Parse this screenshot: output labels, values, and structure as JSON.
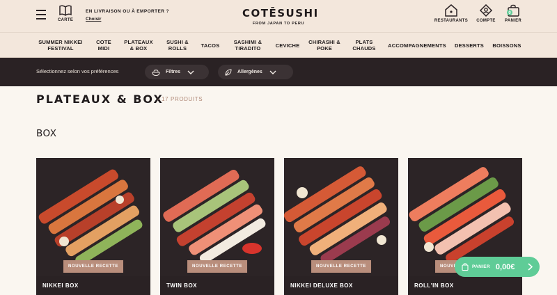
{
  "header": {
    "carte_label": "CARTE",
    "delivery_line": "EN LIVRAISON OU À EMPORTER ?",
    "delivery_link": "Choisir",
    "logo_name": "COTĒSUSHI",
    "logo_tagline": "FROM JAPAN TO PERU",
    "restaurants_label": "RESTAURANTS",
    "compte_label": "COMPTE",
    "panier_label": "PANIER",
    "panier_count": "0"
  },
  "nav": {
    "items": [
      "SUMMER NIKKEI\nFESTIVAL",
      "COTE\nMIDI",
      "PLATEAUX\n& BOX",
      "SUSHI &\nROLLS",
      "TACOS",
      "SASHIMI &\nTIRADITO",
      "CEVICHE",
      "CHIRASHI &\nPOKE",
      "PLATS\nCHAUDS",
      "ACCOMPAGNEMENTS",
      "DESSERTS",
      "BOISSONS"
    ]
  },
  "filters": {
    "prompt": "Sélectionnez selon vos préférences",
    "filtres_label": "Filtres",
    "allergenes_label": "Allergènes"
  },
  "page": {
    "title": "PLATEAUX & BOX",
    "count": "- 17 PRODUITS",
    "section": "BOX"
  },
  "products": [
    {
      "name": "NIKKEI BOX",
      "badge": "NOUVELLE RECETTE"
    },
    {
      "name": "TWIN BOX",
      "badge": "NOUVELLE RECETTE"
    },
    {
      "name": "NIKKEI DELUXE BOX",
      "badge": "NOUVELLE RECETTE"
    },
    {
      "name": "ROLL'IN BOX",
      "badge": "NOUVELLE RECETTE"
    }
  ],
  "cart_button": {
    "label": "PANIER",
    "amount": "0,00€"
  },
  "colors": {
    "header_bg": "#f3e7dc",
    "dark_bar": "#2a2224",
    "badge": "#b98e7c",
    "cart_green": "#5fcc97",
    "count_text": "#b18a78"
  }
}
